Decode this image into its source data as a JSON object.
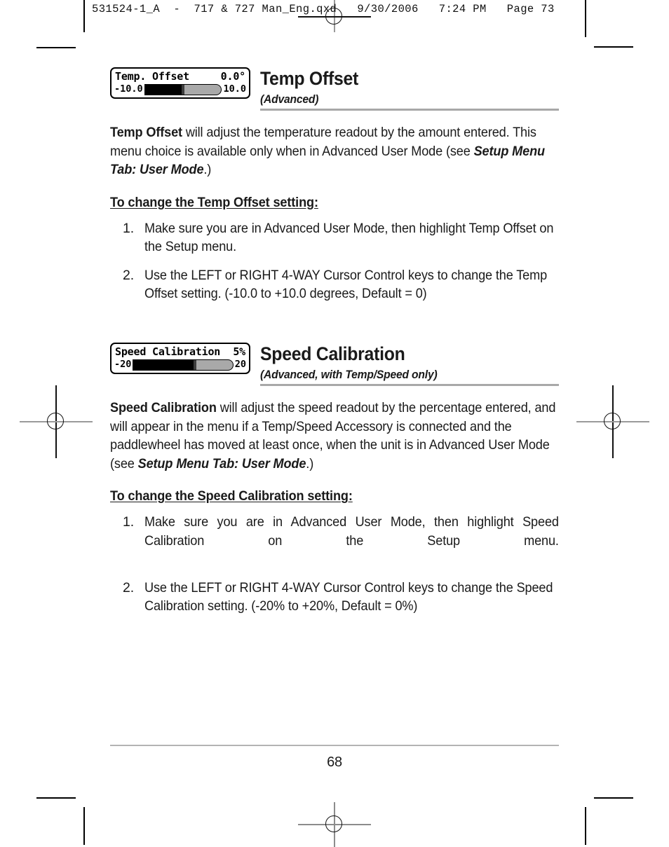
{
  "print_marks": {
    "job_header": "531524-1_A  -  717 & 727 Man_Eng.qxd   9/30/2006   7:24 PM   Page 73"
  },
  "sections": [
    {
      "lcd": {
        "title": "Temp. Offset",
        "value": "0.0°",
        "min_label": "-10.0",
        "max_label": "10.0",
        "fill_percent": 50,
        "thumb_percent": 50
      },
      "title": "Temp Offset",
      "subtitle": "(Advanced)",
      "paragraph": {
        "lead": "Temp Offset",
        "text_1": " will adjust the temperature readout by the amount entered. This menu choice is available only when in Advanced User Mode  (see ",
        "ref": "Setup Menu Tab: User Mode",
        "text_2": ".)"
      },
      "howto": "To change the Temp Offset setting:",
      "steps": [
        {
          "num": "1.",
          "text": "Make sure you are in Advanced User Mode, then highlight Temp Offset on the Setup menu.",
          "justified": false
        },
        {
          "num": "2.",
          "text": "Use the LEFT or RIGHT 4-WAY Cursor Control keys to change the Temp Offset setting. (-10.0 to +10.0 degrees, Default = 0)",
          "justified": false
        }
      ]
    },
    {
      "lcd": {
        "title": "Speed Calibration",
        "value": "5%",
        "min_label": "-20",
        "max_label": "20",
        "fill_percent": 62,
        "thumb_percent": 62
      },
      "title": "Speed Calibration",
      "subtitle": "(Advanced, with Temp/Speed only)",
      "paragraph": {
        "lead": "Speed Calibration",
        "text_1": " will adjust the speed readout by the percentage entered, and will appear in the menu if a Temp/Speed Accessory is connected and the paddlewheel has moved at least once, when the unit is in Advanced User Mode (see ",
        "ref": "Setup Menu Tab: User Mode",
        "text_2": ".)"
      },
      "howto": "To change the Speed Calibration setting:",
      "steps": [
        {
          "num": "1.",
          "text": "Make sure you are in Advanced User Mode, then highlight Speed Calibration on the Setup menu.",
          "justified": true
        },
        {
          "num": "2.",
          "text": "Use the LEFT or RIGHT 4-WAY Cursor Control keys to change the Speed Calibration setting. (-20% to +20%, Default = 0%)",
          "justified": false
        }
      ]
    }
  ],
  "footer": {
    "page_number": "68"
  }
}
